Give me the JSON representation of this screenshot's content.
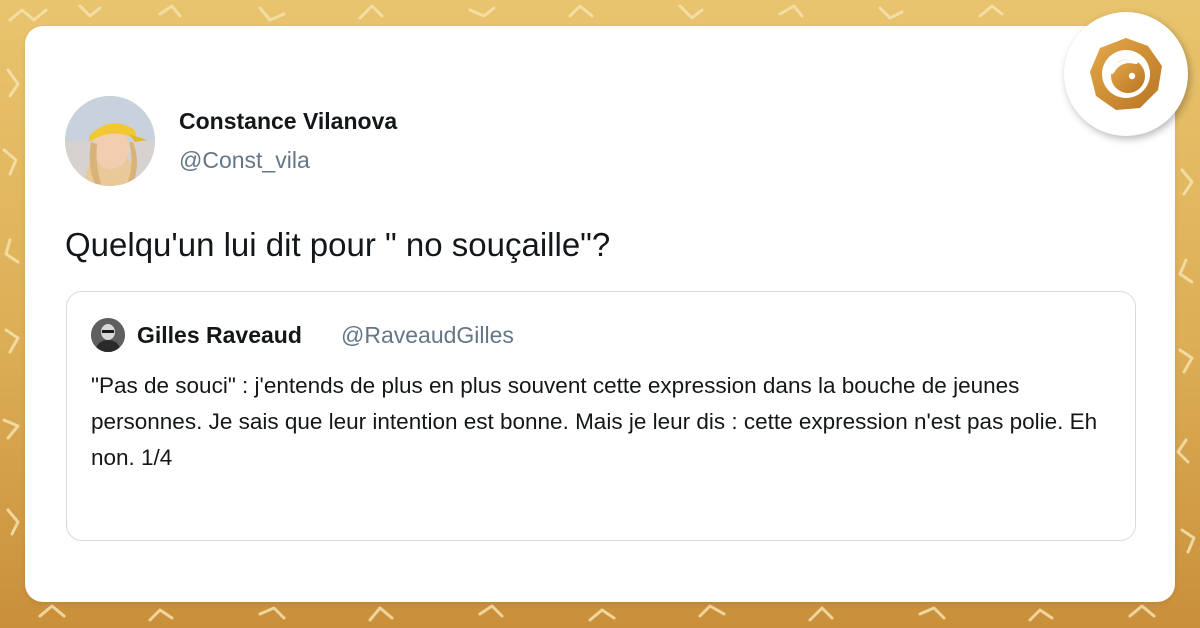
{
  "tweet": {
    "author_name": "Constance Vilanova",
    "author_handle": "@Const_vila",
    "text": "Quelqu'un lui dit pour \" no souçaille\"?"
  },
  "quoted_tweet": {
    "author_name": "Gilles Raveaud",
    "author_handle": "@RaveaudGilles",
    "text": "\"Pas de souci\" : j'entends de plus en plus souvent cette expression dans la bouche de jeunes personnes. Je sais que leur intention est bonne. Mais je leur dis : cette expression n'est pas polie. Eh non. 1/4"
  },
  "colors": {
    "background": "#dcae55",
    "card": "#ffffff",
    "text_primary": "#14171a",
    "text_secondary": "#657786",
    "quote_border": "#d5dce1",
    "logo_accent": "#c8872c"
  },
  "icons": {
    "brand_logo": "gold-bird-badge-icon",
    "avatar": "profile-photo",
    "quoted_avatar": "profile-photo"
  }
}
